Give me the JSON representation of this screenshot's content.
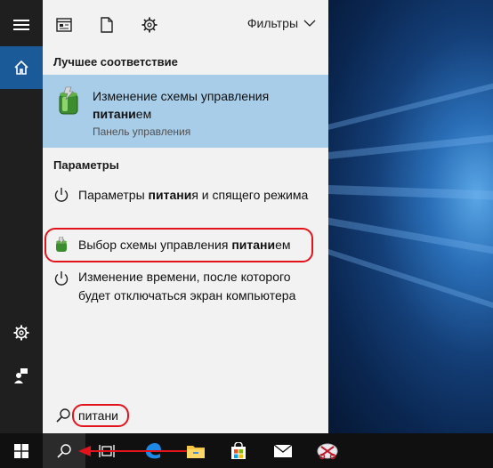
{
  "toolbar": {
    "filters_label": "Фильтры"
  },
  "best_match": {
    "section_title": "Лучшее соответствие",
    "title_pre": "Изменение схемы управления ",
    "title_bold": "питани",
    "title_post": "ем",
    "subtitle": "Панель управления"
  },
  "settings": {
    "section_title": "Параметры",
    "items": [
      {
        "pre": "Параметры ",
        "bold": "питани",
        "post": "я и спящего режима",
        "icon": "power-icon"
      },
      {
        "pre": "Выбор схемы управления ",
        "bold": "питани",
        "post": "ем",
        "icon": "power-plan-icon"
      },
      {
        "pre": "Изменение времени, после которого будет отключаться экран компьютера",
        "bold": "",
        "post": "",
        "icon": "power-icon"
      }
    ]
  },
  "search": {
    "value": "питани"
  },
  "colors": {
    "accent": "#1b5a99",
    "selection": "#a8cde9",
    "highlight_red": "#e3131c"
  }
}
